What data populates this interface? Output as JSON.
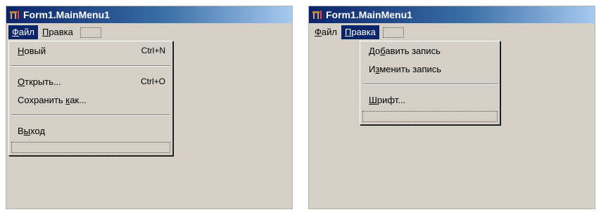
{
  "left_window": {
    "title": "Form1.MainMenu1",
    "menu": [
      {
        "pre": "",
        "ul": "Ф",
        "post": "айл"
      },
      {
        "pre": "",
        "ul": "П",
        "post": "равка"
      }
    ],
    "dropdown": {
      "new": {
        "pre": "",
        "ul": "Н",
        "post": "овый",
        "shortcut": "Ctrl+N"
      },
      "open": {
        "pre": "",
        "ul": "О",
        "post": "ткрыть...",
        "shortcut": "Ctrl+O"
      },
      "save_as": {
        "pre": "Сохранить ",
        "ul": "к",
        "post": "ак..."
      },
      "exit": {
        "pre": "В",
        "ul": "ы",
        "post": "ход"
      }
    }
  },
  "right_window": {
    "title": "Form1.MainMenu1",
    "menu": [
      {
        "pre": "",
        "ul": "Ф",
        "post": "айл"
      },
      {
        "pre": "",
        "ul": "П",
        "post": "равка"
      }
    ],
    "dropdown": {
      "add": {
        "pre": "До",
        "ul": "б",
        "post": "авить запись"
      },
      "edit": {
        "pre": "И",
        "ul": "з",
        "post": "менить запись"
      },
      "font": {
        "pre": "",
        "ul": "Ш",
        "post": "рифт..."
      }
    }
  },
  "icons": {
    "title_icon": "form-designer-icon"
  },
  "colors": {
    "title_start": "#0a246a",
    "title_end": "#a6caf0",
    "face": "#d4d0c8",
    "highlight": "#0a246a"
  }
}
